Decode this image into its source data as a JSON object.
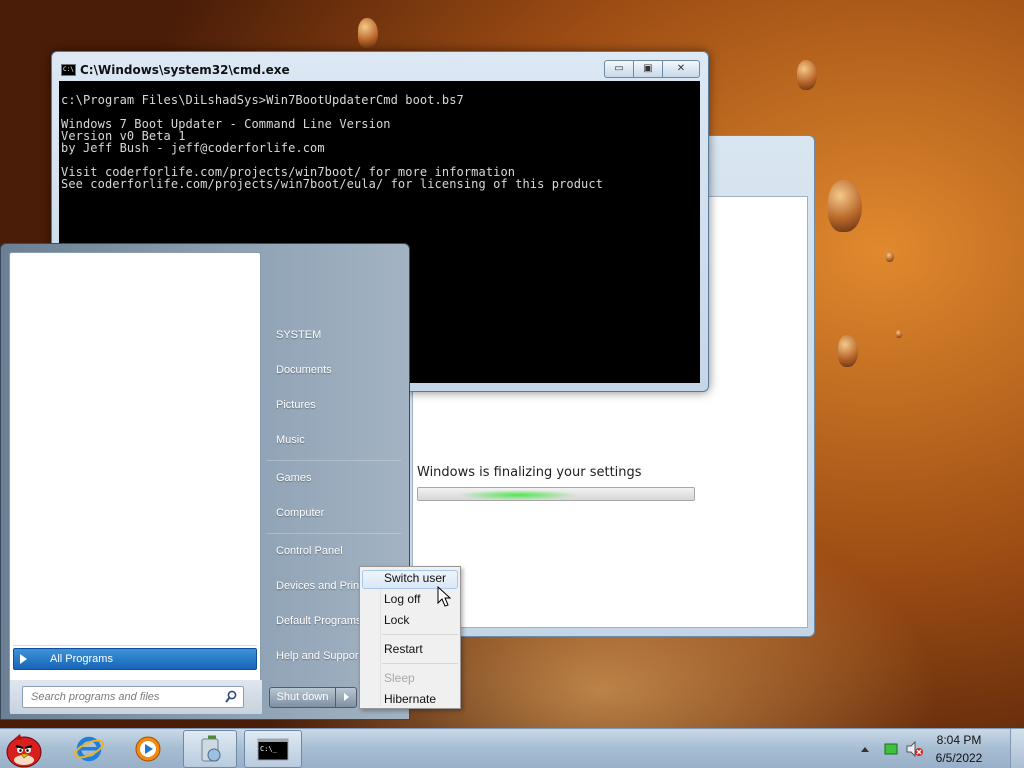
{
  "cmd_window": {
    "title": "C:\\Windows\\system32\\cmd.exe",
    "minimize": "▭",
    "maximize": "▣",
    "close": "✕",
    "lines": [
      "c:\\Program Files\\DiLshadSys>Win7BootUpdaterCmd boot.bs7",
      "Windows 7 Boot Updater - Command Line Version",
      "Version v0 Beta 1",
      "by Jeff Bush - jeff@coderforlife.com",
      "Visit coderforlife.com/projects/win7boot/ for more information",
      "See coderforlife.com/projects/win7boot/eula/ for licensing of this product"
    ]
  },
  "setup_window": {
    "message": "Windows is finalizing your settings"
  },
  "start_menu": {
    "right_items": [
      "SYSTEM",
      "Documents",
      "Pictures",
      "Music",
      "Games",
      "Computer",
      "Control Panel",
      "Devices and Printers",
      "Default Programs",
      "Help and Support"
    ],
    "all_programs": "All Programs",
    "search_placeholder": "Search programs and files",
    "shutdown_label": "Shut down"
  },
  "context_menu": {
    "items": [
      "Switch user",
      "Log off",
      "Lock",
      "Restart",
      "Sleep",
      "Hibernate"
    ],
    "highlighted": "Switch user",
    "disabled": [
      "Sleep"
    ]
  },
  "taskbar": {
    "pinned": [
      "angry-birds",
      "internet-explorer",
      "media-player",
      "media-center",
      "cmd"
    ],
    "clock_time": "8:04 PM",
    "clock_date": "6/5/2022"
  },
  "colors": {
    "start_menu_accent": "#1764b7",
    "cmd_background": "#000000",
    "progress_glow": "#4ee84e"
  }
}
